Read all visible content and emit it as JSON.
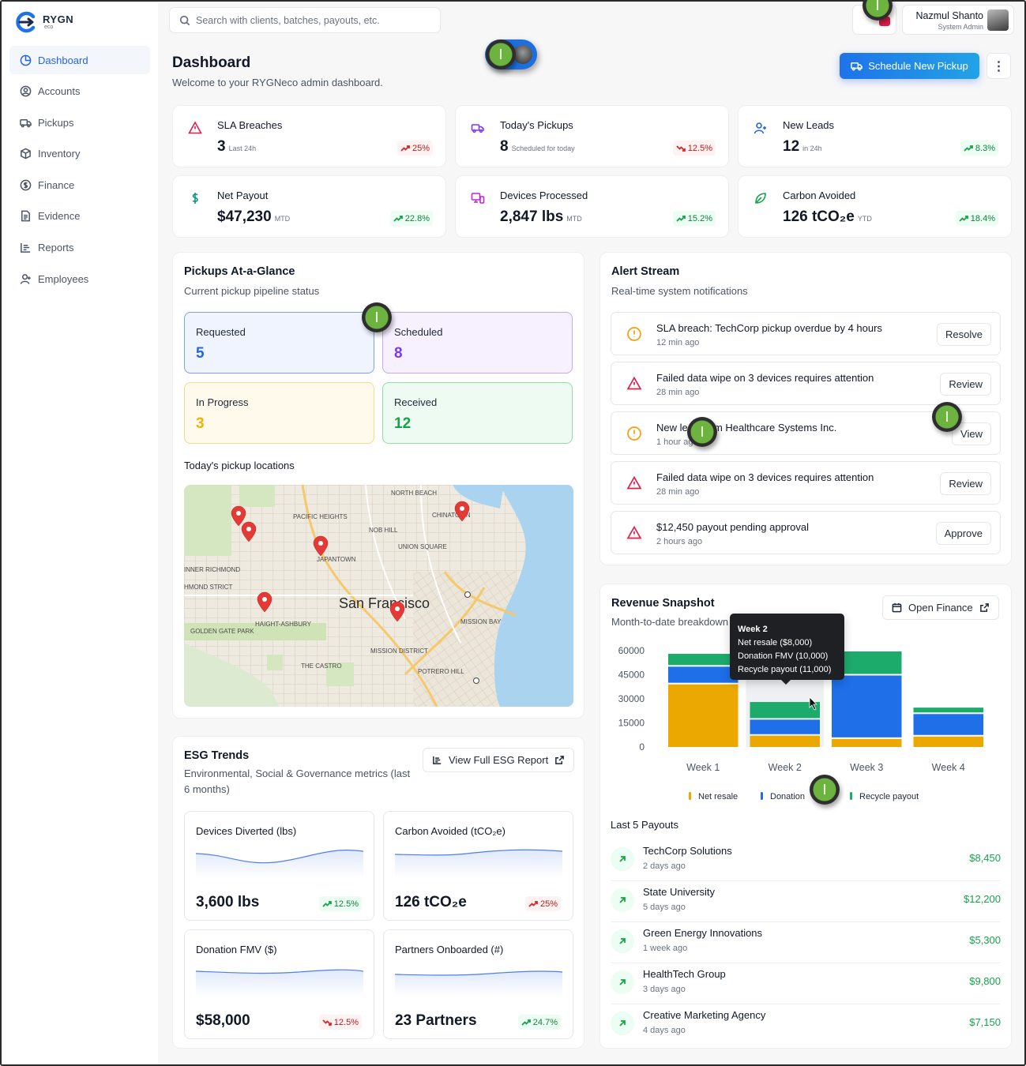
{
  "app": {
    "brand_name": "RYGN",
    "brand_sub": "eco"
  },
  "search": {
    "placeholder": "Search with clients, batches, payouts, etc."
  },
  "user": {
    "name": "Nazmul Shanto",
    "role": "System Admin"
  },
  "sidebar": {
    "items": [
      {
        "label": "Dashboard",
        "icon": "dashboard-icon",
        "active": true
      },
      {
        "label": "Accounts",
        "icon": "user-circle-icon"
      },
      {
        "label": "Pickups",
        "icon": "truck-icon"
      },
      {
        "label": "Inventory",
        "icon": "box-icon"
      },
      {
        "label": "Finance",
        "icon": "dollar-circle-icon"
      },
      {
        "label": "Evidence",
        "icon": "document-icon"
      },
      {
        "label": "Reports",
        "icon": "report-icon"
      },
      {
        "label": "Employees",
        "icon": "user-icon"
      }
    ]
  },
  "header": {
    "title": "Dashboard",
    "subtitle": "Welcome to your RYGNeco admin dashboard.",
    "primary_button": "Schedule New Pickup"
  },
  "stats": [
    {
      "label": "SLA Breaches",
      "value": "3",
      "suffix": "Last 24h",
      "trend": "25%",
      "direction": "up",
      "tone": "bad",
      "icon": "alert-triangle-icon",
      "color": "#e11d48"
    },
    {
      "label": "Today's Pickups",
      "value": "8",
      "suffix": "Scheduled for today",
      "trend": "12.5%",
      "direction": "down",
      "tone": "bad",
      "icon": "truck-icon",
      "color": "#7c3aed"
    },
    {
      "label": "New Leads",
      "value": "12",
      "suffix": "in 24h",
      "trend": "8.3%",
      "direction": "up",
      "tone": "good",
      "icon": "user-plus-icon",
      "color": "#2563eb"
    },
    {
      "label": "Net Payout",
      "value": "$47,230",
      "suffix": "MTD",
      "trend": "22.8%",
      "direction": "up",
      "tone": "good",
      "icon": "dollar-icon",
      "color": "#0d9488"
    },
    {
      "label": "Devices Processed",
      "value": "2,847 lbs",
      "suffix": "MTD",
      "trend": "15.2%",
      "direction": "up",
      "tone": "good",
      "icon": "devices-icon",
      "color": "#c026d3"
    },
    {
      "label": "Carbon Avoided",
      "value": "126 tCO₂e",
      "suffix": "YTD",
      "trend": "18.4%",
      "direction": "up",
      "tone": "good",
      "icon": "leaf-icon",
      "color": "#16a34a"
    }
  ],
  "pickups": {
    "title": "Pickups At-a-Glance",
    "subtitle": "Current pickup pipeline status",
    "statuses": [
      {
        "label": "Requested",
        "value": "5",
        "color": "#2563eb",
        "bg": "#eff4ff",
        "border": "#7aa2f7"
      },
      {
        "label": "Scheduled",
        "value": "8",
        "color": "#7c3aed",
        "bg": "#f6f0ff",
        "border": "#c4a8f7"
      },
      {
        "label": "In Progress",
        "value": "3",
        "color": "#eab308",
        "bg": "#fffaeb",
        "border": "#f6d98a"
      },
      {
        "label": "Received",
        "value": "12",
        "color": "#16a34a",
        "bg": "#eefbf3",
        "border": "#8fdcaa"
      }
    ],
    "map_title": "Today's pickup locations",
    "map": {
      "city": "San Francisco",
      "neighborhoods": [
        "NORTH BEACH",
        "PACIFIC HEIGHTS",
        "CHINATOWN",
        "NOB HILL",
        "UNION SQUARE",
        "JAPANTOWN",
        "INNER RICHMOND",
        "HMOND STRICT",
        "HAIGHT-ASHBURY",
        "GOLDEN GATE PARK",
        "MISSION BAY",
        "MISSION DISTRICT",
        "THE CASTRO",
        "POTRERO HILL"
      ]
    }
  },
  "alerts": {
    "title": "Alert Stream",
    "subtitle": "Real-time system notifications",
    "items": [
      {
        "text": "SLA breach: TechCorp pickup overdue by 4 hours",
        "time": "12 min ago",
        "action": "Resolve",
        "icon": "clock-alert-icon",
        "color": "#f59e0b"
      },
      {
        "text": "Failed data wipe on 3 devices requires attention",
        "time": "28 min ago",
        "action": "Review",
        "icon": "alert-triangle-icon",
        "color": "#e11d48"
      },
      {
        "text": "New lead from Healthcare Systems Inc.",
        "time": "1 hour ago",
        "action": "View",
        "icon": "clock-alert-icon",
        "color": "#f59e0b"
      },
      {
        "text": "Failed data wipe on 3 devices requires attention",
        "time": "28 min ago",
        "action": "Review",
        "icon": "alert-triangle-icon",
        "color": "#e11d48"
      },
      {
        "text": "$12,450 payout pending approval",
        "time": "2 hours ago",
        "action": "Approve",
        "icon": "alert-triangle-icon",
        "color": "#e11d48"
      }
    ]
  },
  "esg": {
    "title": "ESG Trends",
    "subtitle": "Environmental, Social & Governance metrics (last 6 months)",
    "button": "View Full ESG Report",
    "metrics": [
      {
        "label": "Devices Diverted (lbs)",
        "value": "3,600 lbs",
        "trend": "12.5%",
        "direction": "up"
      },
      {
        "label": "Carbon Avoided (tCO₂e)",
        "value": "126 tCO₂e",
        "trend": "25%",
        "direction": "up",
        "tone": "bad"
      },
      {
        "label": "Donation FMV ($)",
        "value": "$58,000",
        "trend": "12.5%",
        "direction": "down"
      },
      {
        "label": "Partners Onboarded (#)",
        "value": "23 Partners",
        "trend": "24.7%",
        "direction": "up"
      }
    ]
  },
  "revenue": {
    "title": "Revenue Snapshot",
    "subtitle": "Month-to-date breakdown",
    "button": "Open Finance",
    "tooltip": {
      "title": "Week 2",
      "lines": [
        "Net resale ($8,000)",
        "Donation FMV (10,000)",
        "Recycle payout (11,000)"
      ]
    },
    "payouts_title": "Last 5 Payouts",
    "payouts": [
      {
        "name": "TechCorp Solutions",
        "time": "2 days ago",
        "amount": "$8,450"
      },
      {
        "name": "State University",
        "time": "5 days ago",
        "amount": "$12,200"
      },
      {
        "name": "Green Energy Innovations",
        "time": "1 week ago",
        "amount": "$5,300"
      },
      {
        "name": "HealthTech Group",
        "time": "3 days ago",
        "amount": "$9,800"
      },
      {
        "name": "Creative Marketing Agency",
        "time": "4 days ago",
        "amount": "$7,150"
      }
    ]
  },
  "chart_data": {
    "type": "bar",
    "stacked": true,
    "categories": [
      "Week 1",
      "Week 2",
      "Week 3",
      "Week 4"
    ],
    "series": [
      {
        "name": "Net resale",
        "color": "#eaa800",
        "values": [
          40000,
          8000,
          6000,
          7500
        ]
      },
      {
        "name": "Donation",
        "color": "#1e6fe8",
        "values": [
          11000,
          10000,
          39500,
          14000
        ]
      },
      {
        "name": "Recycle payout",
        "color": "#1dab6c",
        "values": [
          8000,
          11000,
          15000,
          4000
        ]
      }
    ],
    "yticks": [
      "0",
      "15000",
      "30000",
      "45000",
      "60000"
    ],
    "ylim": [
      0,
      60000
    ],
    "grid": false,
    "legend_position": "bottom"
  }
}
